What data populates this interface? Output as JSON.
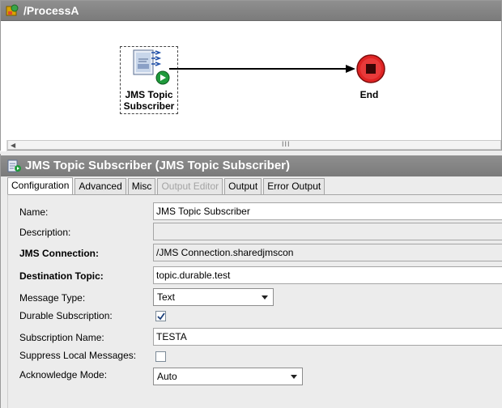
{
  "process": {
    "title": "/ProcessA",
    "activity": {
      "label_line1": "JMS Topic",
      "label_line2": "Subscriber"
    },
    "end": {
      "label": "End"
    },
    "scrollbar_grip": "III"
  },
  "editor": {
    "title": "JMS Topic Subscriber (JMS Topic Subscriber)",
    "tabs": [
      {
        "label": "Configuration",
        "state": "active"
      },
      {
        "label": "Advanced",
        "state": "normal"
      },
      {
        "label": "Misc",
        "state": "normal"
      },
      {
        "label": "Output Editor",
        "state": "disabled"
      },
      {
        "label": "Output",
        "state": "normal"
      },
      {
        "label": "Error Output",
        "state": "normal"
      }
    ],
    "fields": {
      "name": {
        "label": "Name:",
        "value": "JMS Topic Subscriber"
      },
      "description": {
        "label": "Description:",
        "value": ""
      },
      "jms_connection": {
        "label": "JMS Connection:",
        "value": "/JMS Connection.sharedjmscon"
      },
      "destination_topic": {
        "label": "Destination Topic:",
        "value": "topic.durable.test"
      },
      "message_type": {
        "label": "Message Type:",
        "value": "Text"
      },
      "durable_subscription": {
        "label": "Durable Subscription:",
        "checked": true
      },
      "subscription_name": {
        "label": "Subscription Name:",
        "value": "TESTA"
      },
      "suppress_local": {
        "label": "Suppress Local Messages:",
        "checked": false
      },
      "acknowledge_mode": {
        "label": "Acknowledge Mode:",
        "value": "Auto"
      }
    }
  },
  "colors": {
    "title_bar": "#878787",
    "end_red": "#e02424",
    "start_green": "#1f9a3c",
    "background": "#ececec"
  },
  "icons": [
    "process-icon",
    "jms-subscriber-icon",
    "end-icon",
    "activity-editor-icon",
    "checkmark-icon",
    "dropdown-caret-icon"
  ]
}
